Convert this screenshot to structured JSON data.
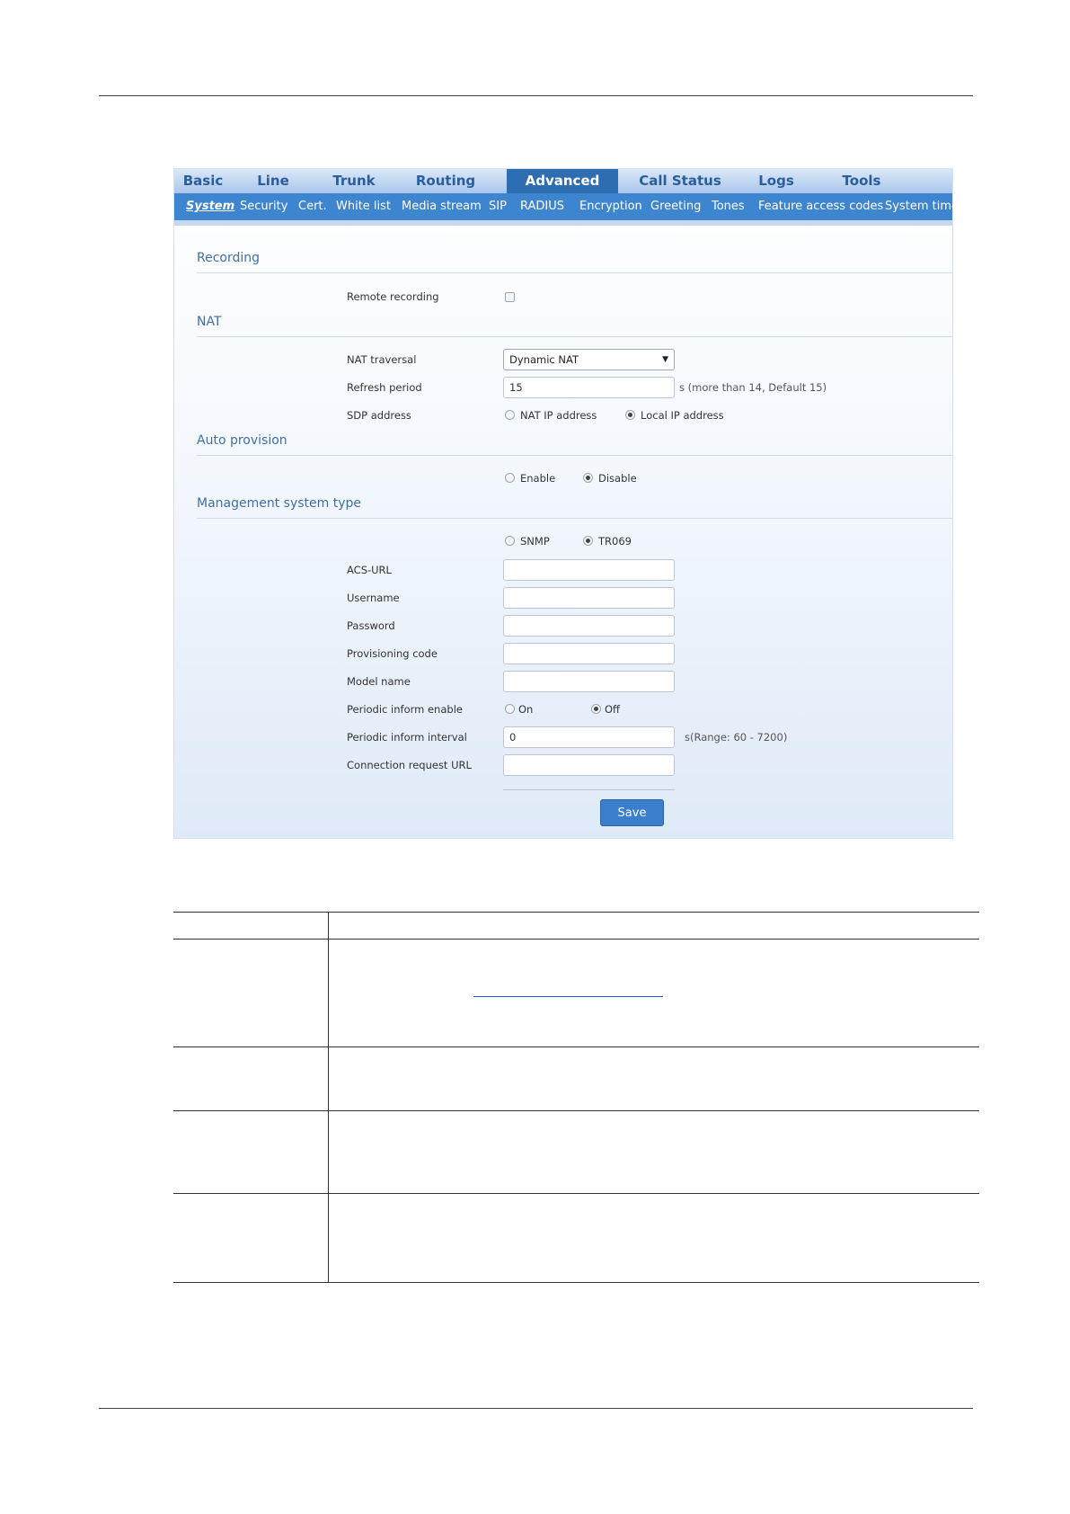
{
  "topnav": {
    "tabs": [
      {
        "label": "Basic"
      },
      {
        "label": "Line"
      },
      {
        "label": "Trunk"
      },
      {
        "label": "Routing"
      },
      {
        "label": "Advanced"
      },
      {
        "label": "Call Status"
      },
      {
        "label": "Logs"
      },
      {
        "label": "Tools"
      }
    ],
    "active": "Advanced"
  },
  "subnav": {
    "items": [
      {
        "label": "System"
      },
      {
        "label": "Security"
      },
      {
        "label": "Cert."
      },
      {
        "label": "White list"
      },
      {
        "label": "Media stream"
      },
      {
        "label": "SIP"
      },
      {
        "label": "RADIUS"
      },
      {
        "label": "Encryption"
      },
      {
        "label": "Greeting"
      },
      {
        "label": "Tones"
      },
      {
        "label": "Feature access codes"
      },
      {
        "label": "System time"
      }
    ],
    "active": "System"
  },
  "recording": {
    "title": "Recording",
    "remote_recording_label": "Remote recording",
    "remote_recording_checked": false
  },
  "nat": {
    "title": "NAT",
    "traversal_label": "NAT traversal",
    "traversal_value": "Dynamic NAT",
    "refresh_label": "Refresh period",
    "refresh_value": "15",
    "refresh_hint": "s (more than 14, Default 15)",
    "sdp_label": "SDP address",
    "sdp_option_nat": "NAT IP address",
    "sdp_option_local": "Local IP address",
    "sdp_selected": "Local IP address"
  },
  "auto_provision": {
    "title": "Auto provision",
    "enable_label": "Enable",
    "disable_label": "Disable",
    "selected": "Disable"
  },
  "management": {
    "title": "Management system type",
    "snmp_label": "SNMP",
    "tr069_label": "TR069",
    "selected": "TR069",
    "acs_url_label": "ACS-URL",
    "acs_url_value": "",
    "username_label": "Username",
    "username_value": "",
    "password_label": "Password",
    "password_value": "",
    "provisioning_code_label": "Provisioning code",
    "provisioning_code_value": "",
    "model_name_label": "Model name",
    "model_name_value": "",
    "periodic_enable_label": "Periodic inform enable",
    "periodic_on_label": "On",
    "periodic_off_label": "Off",
    "periodic_selected": "Off",
    "periodic_interval_label": "Periodic inform interval",
    "periodic_interval_value": "0",
    "periodic_interval_hint": "s(Range: 60 - 7200)",
    "connection_url_label": "Connection request URL",
    "connection_url_value": ""
  },
  "save_label": "Save",
  "colors": {
    "nav_active": "#2f6db3",
    "subnav_bg": "#3e85d0",
    "section_title": "#3e6fa6",
    "save_button": "#3a7fcb"
  }
}
